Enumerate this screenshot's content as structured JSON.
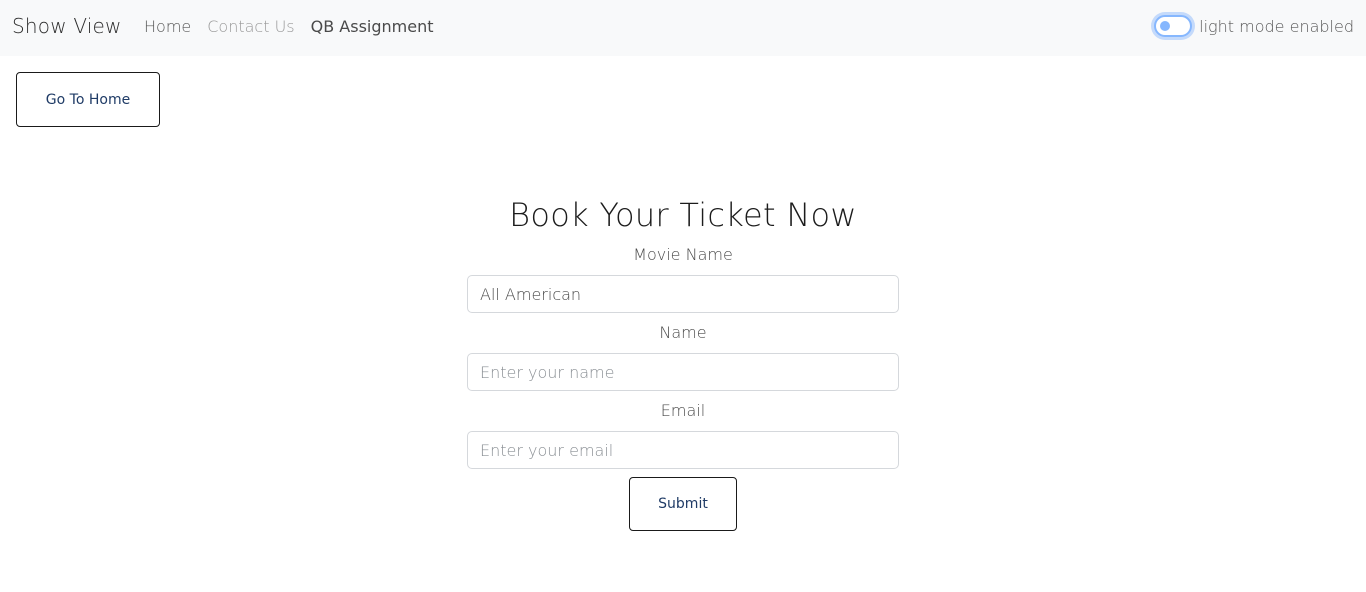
{
  "navbar": {
    "brand": "Show View",
    "links": [
      {
        "label": "Home"
      },
      {
        "label": "Contact Us"
      },
      {
        "label": "QB Assignment"
      }
    ],
    "mode_toggle": {
      "label": "light mode enabled",
      "checked": false
    }
  },
  "home_button": {
    "label": "Go To Home"
  },
  "form": {
    "title": "Book Your Ticket Now",
    "movie": {
      "label": "Movie Name",
      "value": "All American",
      "placeholder": ""
    },
    "name": {
      "label": "Name",
      "value": "",
      "placeholder": "Enter your name"
    },
    "email": {
      "label": "Email",
      "value": "",
      "placeholder": "Enter your email"
    },
    "submit_label": "Submit"
  },
  "colors": {
    "navbar_bg": "#f8f9fa",
    "accent": "#86b7fe",
    "button_text": "#1f3b66"
  }
}
